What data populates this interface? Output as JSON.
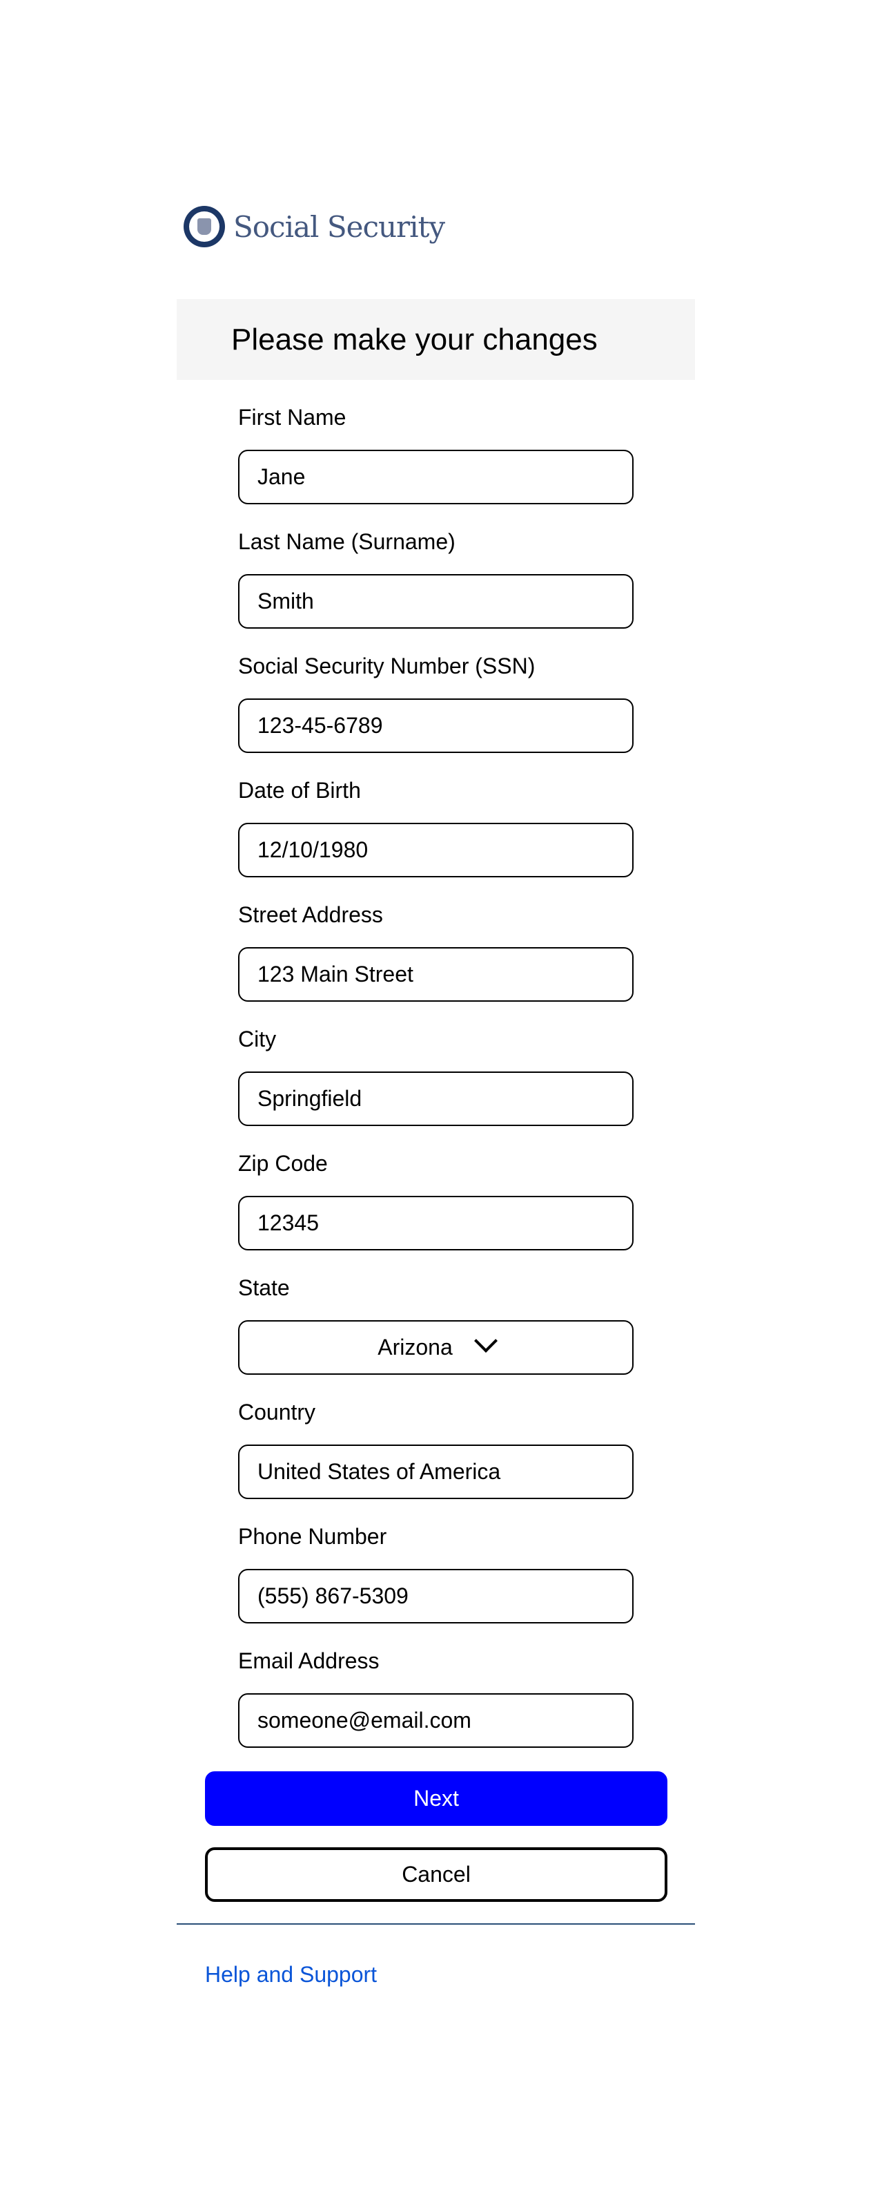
{
  "brand": {
    "name": "Social Security"
  },
  "header": {
    "title": "Please make your changes"
  },
  "fields": [
    {
      "label": "First Name",
      "value": "Jane"
    },
    {
      "label": "Last Name (Surname)",
      "value": "Smith"
    },
    {
      "label": "Social Security Number (SSN)",
      "value": "123-45-6789"
    },
    {
      "label": "Date of Birth",
      "value": "12/10/1980"
    },
    {
      "label": "Street Address",
      "value": "123 Main Street"
    },
    {
      "label": "City",
      "value": "Springfield"
    },
    {
      "label": "Zip Code",
      "value": "12345"
    },
    {
      "label": "State",
      "value": "Arizona"
    },
    {
      "label": "Country",
      "value": "United States of America"
    },
    {
      "label": "Phone Number",
      "value": "(555) 867-5309"
    },
    {
      "label": "Email Address",
      "value": "someone@email.com"
    }
  ],
  "buttons": {
    "next": "Next",
    "cancel": "Cancel"
  },
  "footer": {
    "help": "Help and Support"
  },
  "colors": {
    "primary": "#0000ff",
    "link": "#0a55d8",
    "header_bg": "#f5f5f5"
  }
}
